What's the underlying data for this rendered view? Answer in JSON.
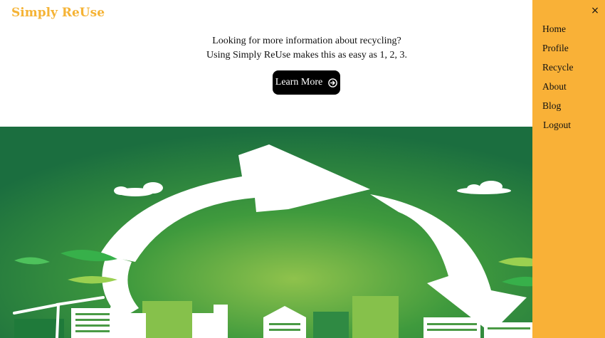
{
  "brand": {
    "name": "Simply ReUse"
  },
  "intro": {
    "line1": "Looking for more information about recycling?",
    "line2": "Using Simply ReUse makes this as easy as 1, 2, 3.",
    "cta_label": "Learn More",
    "cta_icon": "arrow-circle-right-icon"
  },
  "sidebar": {
    "close_icon": "close-icon",
    "close_glyph": "×",
    "items": [
      {
        "label": "Home"
      },
      {
        "label": "Profile"
      },
      {
        "label": "Recycle"
      },
      {
        "label": "About"
      },
      {
        "label": "Blog"
      },
      {
        "label": "Logout"
      }
    ]
  },
  "hero": {
    "image": "recycling-arrows-city-illustration"
  },
  "colors": {
    "brand": "#f5b335",
    "sidebar": "#f9b137",
    "button": "#000000",
    "hero_green": "#2e8a3e"
  }
}
